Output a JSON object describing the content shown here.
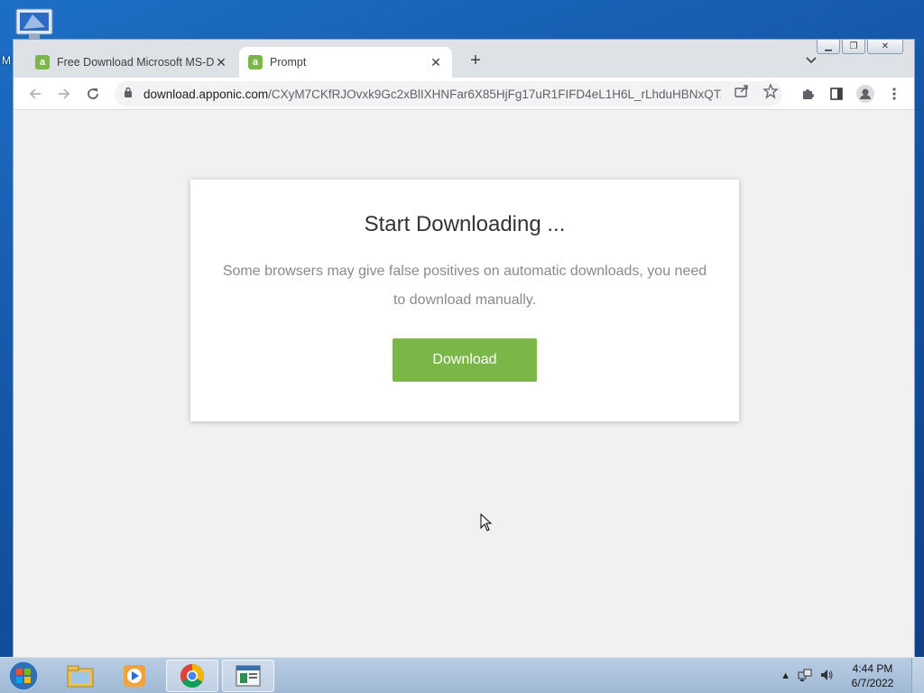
{
  "desktop": {
    "icon_label": "M"
  },
  "browser": {
    "tabs": [
      {
        "title": "Free Download Microsoft MS-DOS",
        "favicon": "a",
        "active": false
      },
      {
        "title": "Prompt",
        "favicon": "a",
        "active": true
      }
    ],
    "url_host": "download.apponic.com",
    "url_path": "/CXyM7CKfRJOvxk9Gc2xBlIXHNFar6X85HjFg17uR1FIFD4eL1H6L_rLhduHBNxQT...",
    "accent_color": "#7ab648"
  },
  "page": {
    "title": "Start Downloading ...",
    "message": "Some browsers may give false positives on automatic downloads, you need to download manually.",
    "download_label": "Download"
  },
  "taskbar": {
    "time": "4:44 PM",
    "date": "6/7/2022"
  }
}
